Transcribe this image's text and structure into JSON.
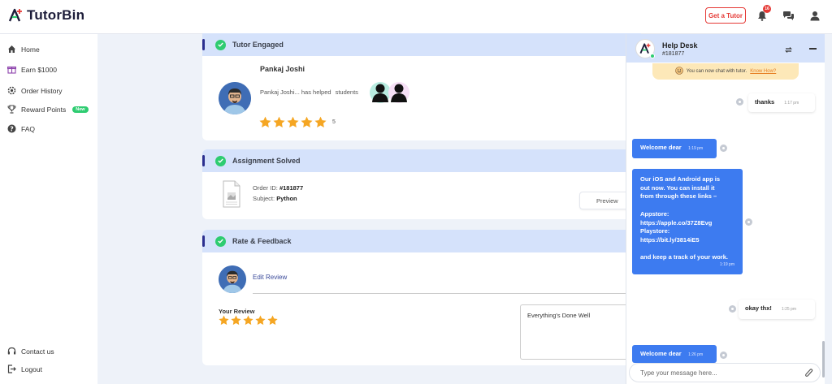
{
  "brand": {
    "name": "TutorBin"
  },
  "header": {
    "get_tutor": "Get a Tutor",
    "notification_count": "16"
  },
  "sidebar": {
    "items": [
      {
        "label": "Home",
        "icon": "home-icon"
      },
      {
        "label": "Earn $1000",
        "icon": "gift-icon"
      },
      {
        "label": "Order History",
        "icon": "gear-icon"
      },
      {
        "label": "Reward Points",
        "icon": "trophy-icon",
        "badge": "New"
      },
      {
        "label": "FAQ",
        "icon": "question-icon"
      }
    ],
    "bottom": [
      {
        "label": "Contact us",
        "icon": "headset-icon"
      },
      {
        "label": "Logout",
        "icon": "logout-icon"
      }
    ]
  },
  "tutor_engaged": {
    "title": "Tutor Engaged",
    "tutor_name": "Pankaj Joshi",
    "helped_text": "Pankaj Joshi... has helped",
    "students_label": "students",
    "rating": 5,
    "rating_text": "5"
  },
  "assignment": {
    "title": "Assignment Solved",
    "order_label": "Order ID:",
    "order_id": "#181877",
    "subject_label": "Subject:",
    "subject": "Python",
    "preview": "Preview"
  },
  "feedback": {
    "title": "Rate & Feedback",
    "edit_review": "Edit Review",
    "your_review": "Your Review",
    "rating": 5,
    "review_text": "Everything's Done Well"
  },
  "chat": {
    "title": "Help Desk",
    "subtitle": "#181877",
    "notice": "You can now chat with tutor.",
    "notice_link": "Know How?",
    "messages": [
      {
        "from": "user",
        "text": "thanks",
        "time": "1:17 pm"
      },
      {
        "from": "support",
        "text": "Welcome dear",
        "time": "1:19 pm"
      },
      {
        "from": "support",
        "lines": [
          "Our iOS and Android app is",
          "out now. You can install it",
          "from through these links –",
          "",
          "Appstore:",
          "https://apple.co/37Z8Evg",
          "Playstore:",
          "https://bit.ly/3814iE5",
          "",
          "and keep a track of your work."
        ],
        "time": "1:19 pm"
      },
      {
        "from": "user",
        "text": "okay thx!",
        "time": "1:25 pm"
      },
      {
        "from": "support",
        "text": "Welcome dear",
        "time": "1:26 pm"
      }
    ],
    "input_placeholder": "Type your message here..."
  },
  "colors": {
    "accent": "#3d7bf0",
    "header_band": "#d5e2fb",
    "success": "#2ecc71",
    "star": "#f5a623",
    "danger": "#e53935"
  }
}
